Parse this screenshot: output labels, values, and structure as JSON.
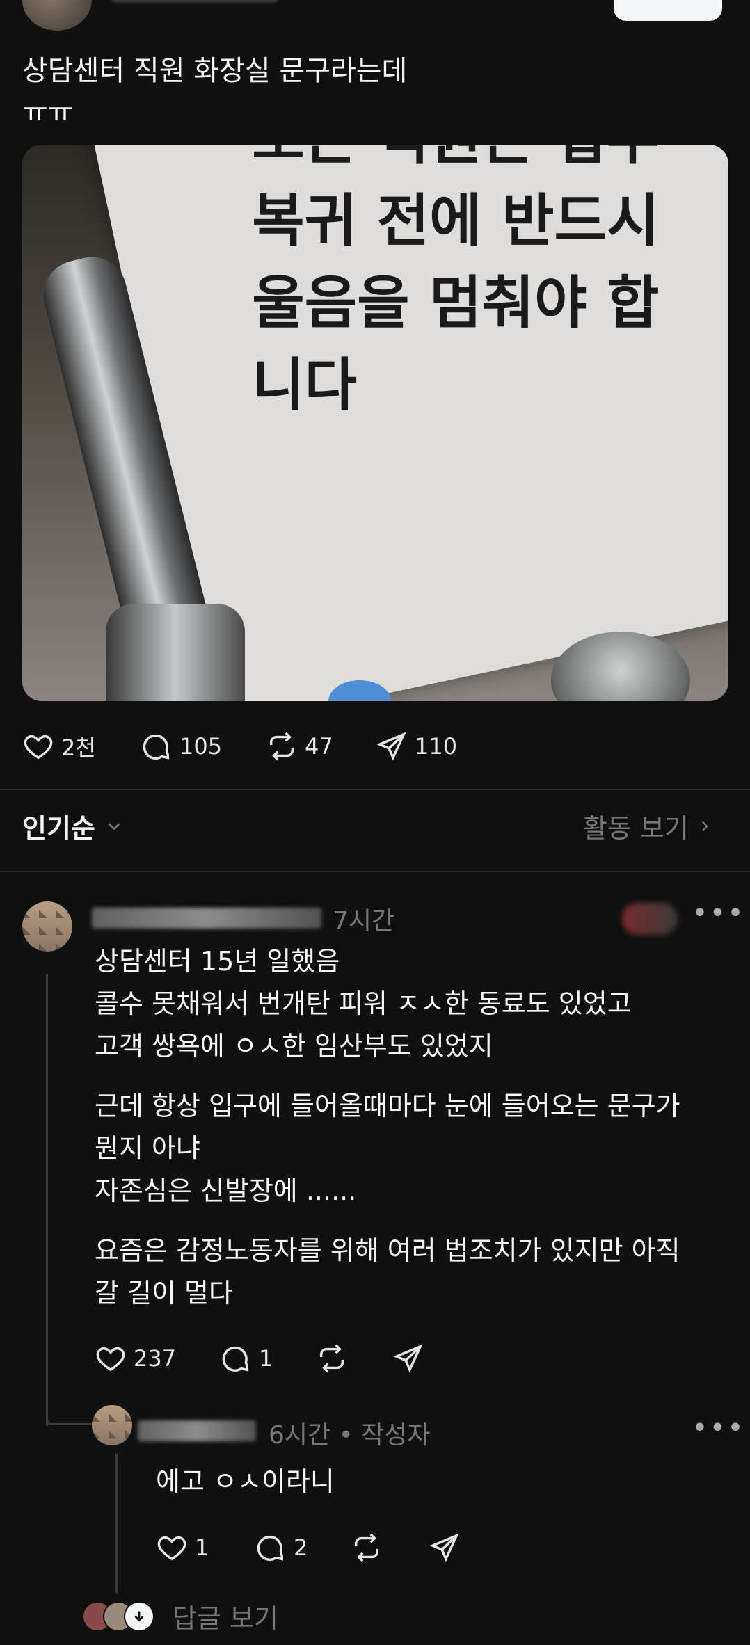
{
  "post": {
    "text": "상담센터 직원 화장실 문구라는데\nㅠㅠ",
    "image_sign_text": "모든 직원은 업무\n복귀 전에 반드시\n울음을 멈춰야 합니다",
    "actions": {
      "likes": "2천",
      "comments": "105",
      "reposts": "47",
      "shares": "110"
    }
  },
  "sort": {
    "label": "인기순",
    "activity_label": "활동 보기"
  },
  "comment": {
    "time": "7시간",
    "paragraphs": [
      "상담센터 15년 일했음\n 콜수 못채워서 번개탄 피워 ㅈㅅ한 동료도 있었고\n고객 쌍욕에 ㅇㅅ한 임산부도 있었지",
      "근데 항상 입구에 들어올때마다 눈에 들어오는 문구가\n뭔지 아냐\n자존심은 신발장에 ......",
      "요즘은 감정노동자를 위해 여러 법조치가 있지만 아직\n갈 길이 멀다"
    ],
    "actions": {
      "likes": "237",
      "comments": "1"
    }
  },
  "reply": {
    "time": "6시간 • 작성자",
    "text": "에고  ㅇㅅ이라니",
    "actions": {
      "likes": "1",
      "comments": "2"
    }
  },
  "view_replies_label": "답글 보기",
  "colors": {
    "background": "#101010",
    "text": "#f3f5f7",
    "muted": "#777777"
  }
}
